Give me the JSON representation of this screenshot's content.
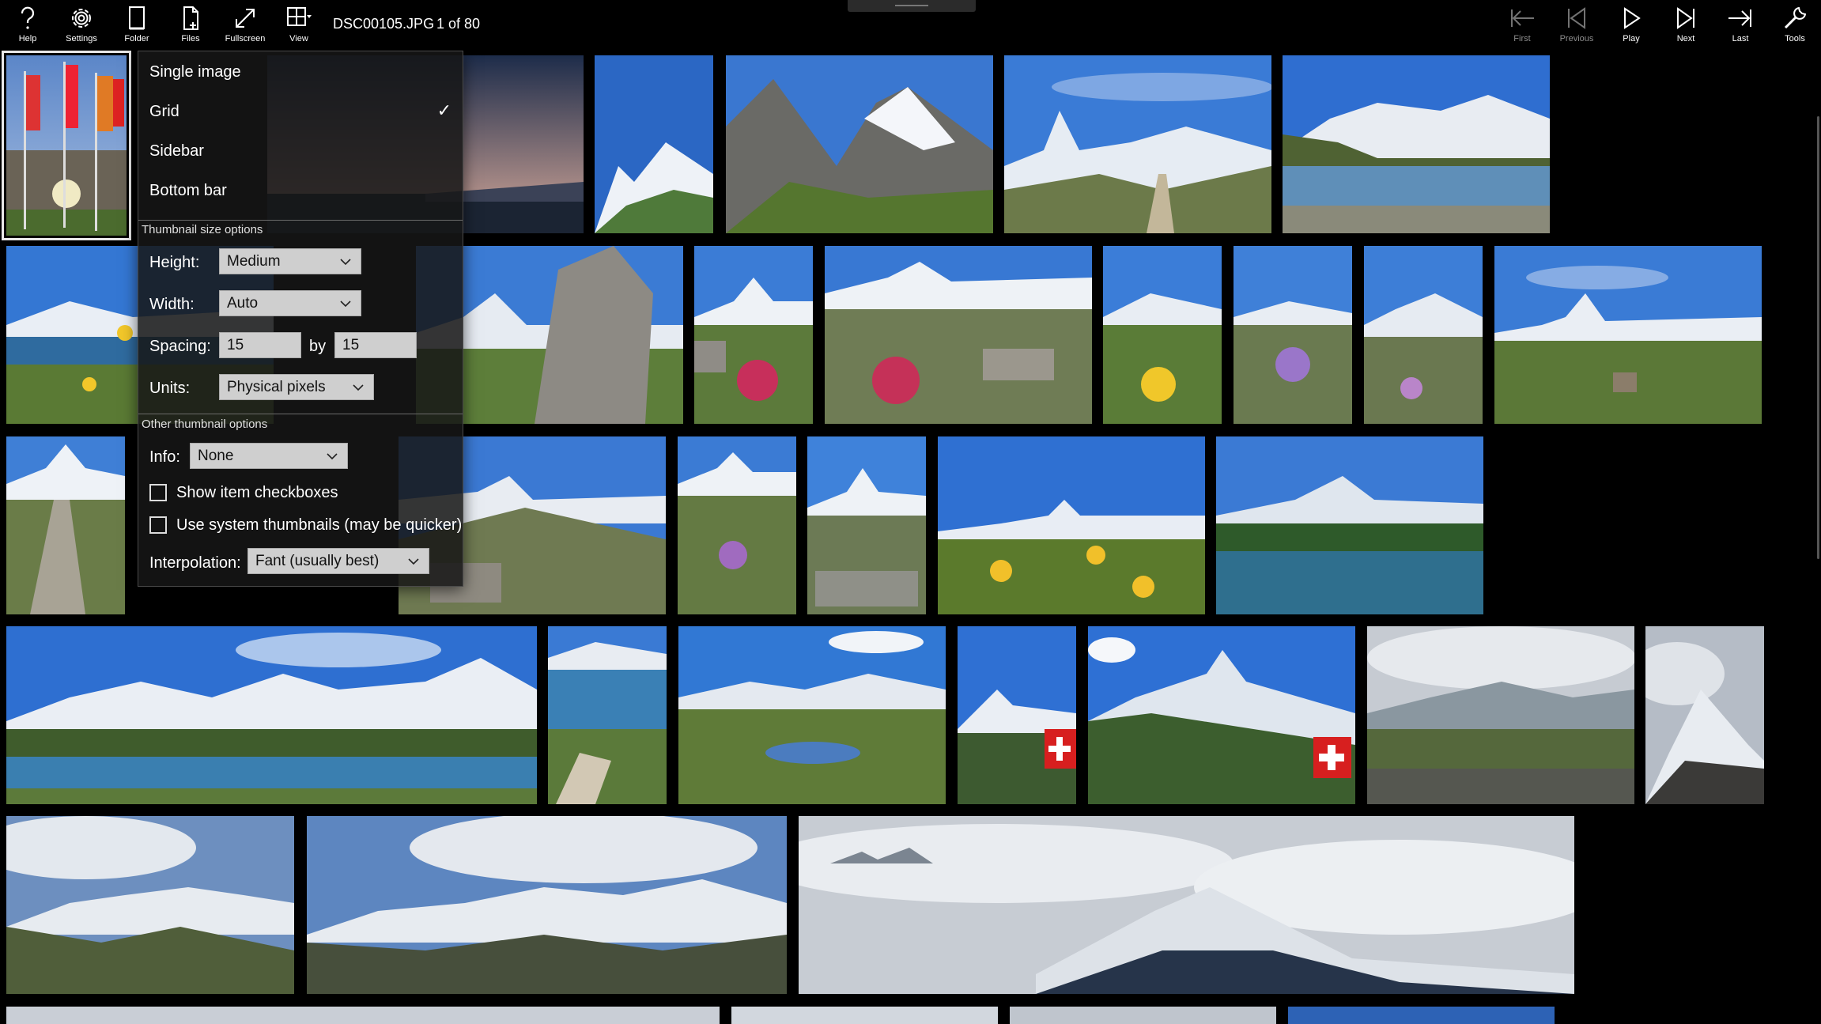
{
  "toolbar": {
    "help": "Help",
    "settings": "Settings",
    "folder": "Folder",
    "files": "Files",
    "fullscreen": "Fullscreen",
    "view": "View",
    "filename": "DSC00105.JPG",
    "counter": "1 of 80",
    "first": "First",
    "previous": "Previous",
    "play": "Play",
    "next": "Next",
    "last": "Last",
    "tools": "Tools"
  },
  "view_menu": {
    "single_image": "Single image",
    "grid": "Grid",
    "sidebar": "Sidebar",
    "bottom_bar": "Bottom bar",
    "checked_item": "Grid",
    "check_glyph": "✓",
    "thumbnail_size_header": "Thumbnail size options",
    "height_label": "Height:",
    "height_value": "Medium",
    "width_label": "Width:",
    "width_value": "Auto",
    "spacing_label": "Spacing:",
    "spacing_x": "15",
    "spacing_by": "by",
    "spacing_y": "15",
    "units_label": "Units:",
    "units_value": "Physical pixels",
    "other_header": "Other thumbnail options",
    "info_label": "Info:",
    "info_value": "None",
    "show_checkboxes": "Show item checkboxes",
    "show_checkboxes_checked": false,
    "use_system_thumbs": "Use system thumbnails (may be quicker)",
    "use_system_thumbs_checked": false,
    "interpolation_label": "Interpolation:",
    "interpolation_value": "Fant (usually best)"
  },
  "colors": {
    "background": "#000000",
    "menu_bg": "#161616",
    "field_bg": "#cfcfcf",
    "selection_outline": "#e8e8e8"
  },
  "icons": [
    "help-icon",
    "settings-icon",
    "folder-icon",
    "files-icon",
    "fullscreen-icon",
    "view-grid-icon",
    "first-icon",
    "previous-icon",
    "play-icon",
    "next-icon",
    "last-icon",
    "tools-icon",
    "checkmark-icon",
    "chevron-down-icon"
  ]
}
